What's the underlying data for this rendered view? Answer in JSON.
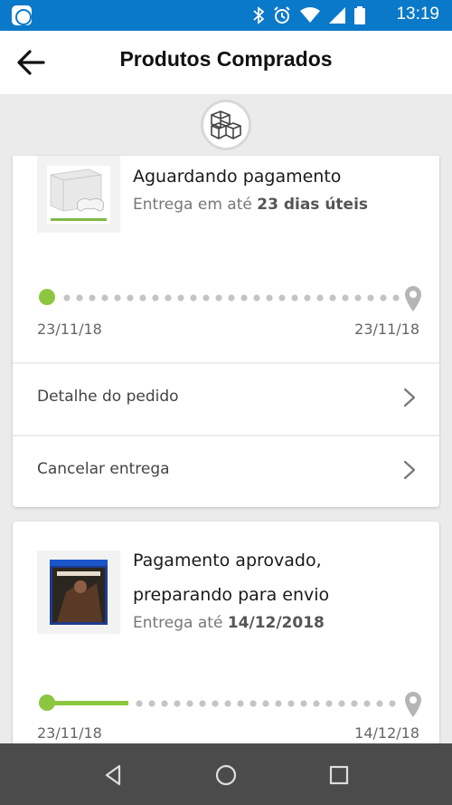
{
  "status_bar": {
    "time": "13:19",
    "app_icon": "app-notification-icon",
    "icons": [
      "bluetooth-icon",
      "alarm-icon",
      "wifi-icon",
      "signal-icon",
      "battery-icon"
    ]
  },
  "header": {
    "title": "Produtos Comprados",
    "back_icon": "arrow-left-icon"
  },
  "header_badge_icon": "boxes-icon",
  "colors": {
    "status_bar": "#0b79c9",
    "accent_green": "#8cc63f",
    "dot_grey": "#c4c4c4",
    "nav_bar": "#4b4b4b"
  },
  "orders": [
    {
      "status": "Aguardando pagamento",
      "delivery_prefix": "Entrega em até",
      "delivery_value": "23 dias úteis",
      "product_icon": "xbox-console-icon",
      "progress": 0,
      "start_date": "23/11/18",
      "end_date": "23/11/18",
      "actions": [
        "Detalhe do pedido",
        "Cancelar entrega"
      ]
    },
    {
      "status_line1": "Pagamento aprovado,",
      "status_line2": "preparando para envio",
      "delivery_prefix": "Entrega até",
      "delivery_value": "14/12/2018",
      "product_icon": "ps4-game-cover-icon",
      "progress": 0.22,
      "start_date": "23/11/18",
      "end_date": "14/12/18"
    }
  ],
  "nav": {
    "back_icon": "nav-back-icon",
    "home_icon": "nav-home-icon",
    "recents_icon": "nav-recents-icon"
  }
}
